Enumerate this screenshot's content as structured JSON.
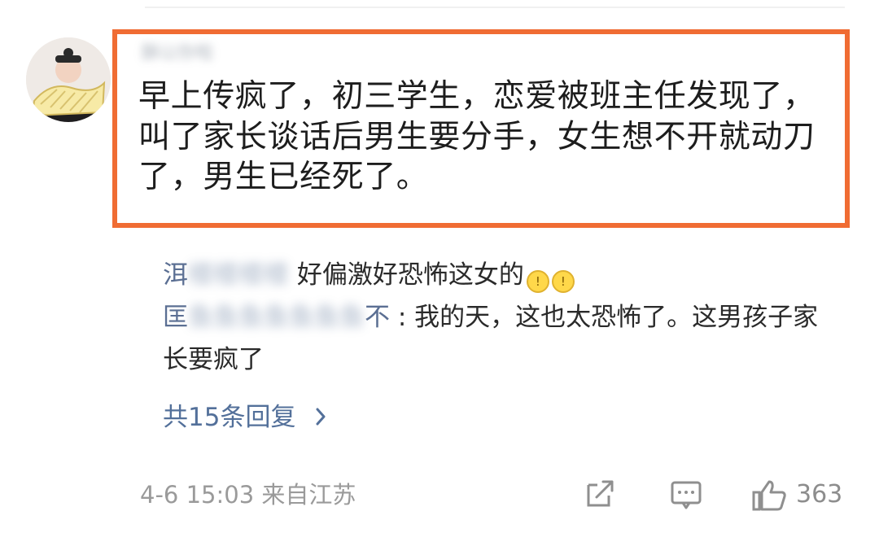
{
  "comment": {
    "username": "酥以你啦",
    "text": "早上传疯了，初三学生，恋爱被班主任发现了，叫了家长谈话后男生要分手，女生想不开就动刀了，男生已经死了。"
  },
  "replies": [
    {
      "user": "洱",
      "user_blur": "楼楼楼楼",
      "text": "好偏激好恐怖这女的",
      "emoji": "😲"
    },
    {
      "user": "匡",
      "user_blur": "鱼鱼鱼鱼鱼鱼鱼",
      "user_end": "不",
      "text": ": 我的天，这也太恐怖了。这男孩子家长要疯了"
    }
  ],
  "more_replies": "共15条回复",
  "meta": "4-6 15:03  来自江苏",
  "actions": {
    "like_count": "363"
  },
  "colors": {
    "highlight": "#f06c33",
    "link": "#53709a"
  }
}
